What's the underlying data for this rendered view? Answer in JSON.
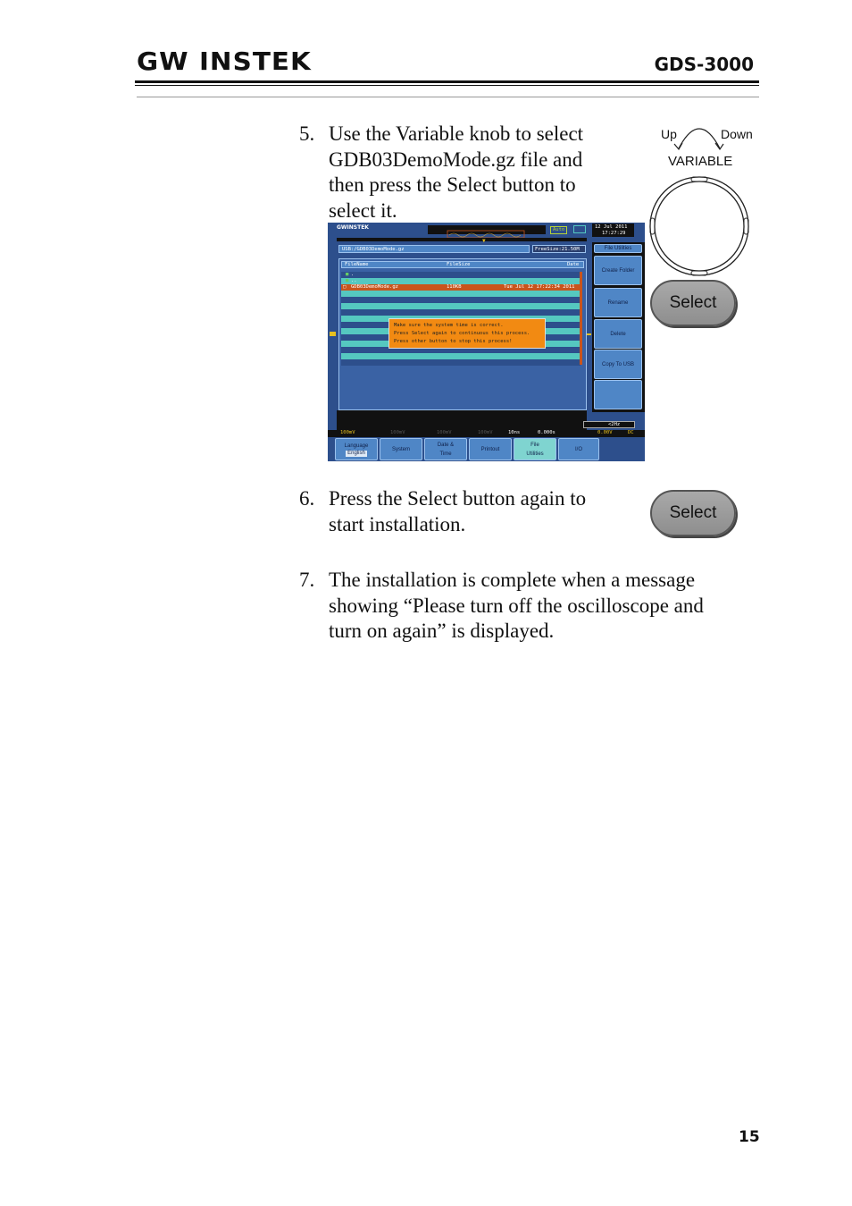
{
  "header": {
    "logo": "GW INSTEK",
    "model": "GDS-3000"
  },
  "steps": [
    {
      "num": "5.",
      "lines": [
        "Use the Variable knob to select",
        "GDB03DemoMode.gz file and",
        "then press the Select button to",
        "select it."
      ]
    },
    {
      "num": "6.",
      "lines": [
        "Press the Select button again to",
        "start installation."
      ]
    },
    {
      "num": "7.",
      "lines": [
        "The installation is complete when a message",
        "showing “Please turn off the oscilloscope and",
        "turn on again” is displayed."
      ]
    }
  ],
  "knob": {
    "up": "Up",
    "down": "Down",
    "label": "VARIABLE"
  },
  "select_button": "Select",
  "scope": {
    "brand": "GWINSTEK",
    "trigger_mode": "Auto",
    "date": "12 Jul 2011",
    "time": "17:27:29",
    "path": "USB:/GDB03DemoMode.gz",
    "free_size": "FreeSize:21.50M",
    "columns": [
      "FileName",
      "FileSize",
      "Date"
    ],
    "files": [
      {
        "name": ".",
        "size": "",
        "date": ""
      },
      {
        "name": "..",
        "size": "",
        "date": ""
      },
      {
        "name": "GDB03DemoMode.gz",
        "size": "110KB",
        "date": "Tue Jul 12 17:22:34 2011"
      }
    ],
    "dialog": [
      "Make sure the system time is correct.",
      "Press Select again to continuous this process.",
      "Press other button to stop this process!"
    ],
    "side_menu": {
      "title": "File Utilities",
      "buttons": [
        "Create Folder",
        "Rename",
        "Delete",
        "Copy To USB",
        ""
      ]
    },
    "freq": "<2Hz",
    "channels": {
      "ch1": "100mV",
      "ch2": "100mV",
      "ch3": "100mV",
      "ch4": "100mV",
      "timebase": "10ns",
      "position": "0.000s",
      "trig_level": "0.00V",
      "coupling": "DC"
    },
    "bottom_menu": [
      {
        "label": "Language",
        "value": "English"
      },
      {
        "label": "System"
      },
      {
        "label": "Date & Time"
      },
      {
        "label": "Printout"
      },
      {
        "label": "File Utilities"
      },
      {
        "label": "I/O"
      }
    ],
    "colors": {
      "background": "#2d4f8c",
      "selected_row": "#c9541c",
      "dialog": "#f28a12",
      "row_teal": "#55c8c0"
    }
  },
  "page_number": "15"
}
